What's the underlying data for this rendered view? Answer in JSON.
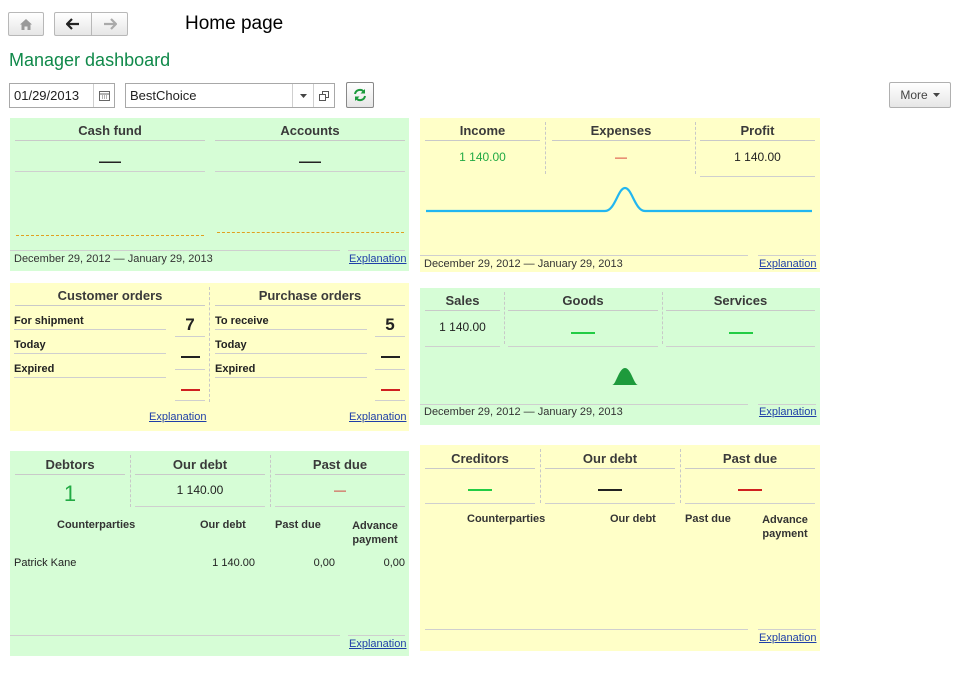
{
  "header": {
    "title": "Home page"
  },
  "dashboard": {
    "title": "Manager dashboard"
  },
  "filters": {
    "date": "01/29/2013",
    "company": "BestChoice",
    "more_label": "More"
  },
  "colors": {
    "green_panel": "#d6fdd6",
    "yellow_panel": "#ffffc8",
    "accent_green": "#10894a",
    "dash_red": "#d02020",
    "dash_green": "#22cc44",
    "link": "#1f3fa8"
  },
  "cash": {
    "cash_fund": "Cash fund",
    "accounts": "Accounts",
    "cash_fund_value": "—",
    "accounts_value": "—",
    "period": "December 29, 2012 — January 29, 2013",
    "explanation": "Explanation"
  },
  "income": {
    "income": "Income",
    "expenses": "Expenses",
    "profit": "Profit",
    "income_value": "1 140.00",
    "expenses_value": "—",
    "profit_value": "1 140.00",
    "period": "December 29, 2012 — January 29, 2013",
    "explanation": "Explanation"
  },
  "orders": {
    "customer": "Customer orders",
    "purchase": "Purchase orders",
    "customer_rows": [
      {
        "label": "For shipment",
        "value": "7"
      },
      {
        "label": "Today",
        "value": "—"
      },
      {
        "label": "Expired",
        "value": "—"
      }
    ],
    "purchase_rows": [
      {
        "label": "To receive",
        "value": "5"
      },
      {
        "label": "Today",
        "value": "—"
      },
      {
        "label": "Expired",
        "value": "—"
      }
    ],
    "explanation": "Explanation"
  },
  "sales": {
    "sales": "Sales",
    "goods": "Goods",
    "services": "Services",
    "sales_value": "1 140.00",
    "goods_value": "—",
    "services_value": "—",
    "period": "December 29, 2012 — January 29, 2013",
    "explanation": "Explanation"
  },
  "debtors": {
    "debtors": "Debtors",
    "our_debt": "Our debt",
    "past_due": "Past due",
    "debtors_value": "1",
    "our_debt_value": "1 140.00",
    "past_due_value": "—",
    "columns": [
      "Counterparties",
      "Our debt",
      "Past due",
      "Advance payment"
    ],
    "rows": [
      {
        "name": "Patrick Kane",
        "our_debt": "1 140.00",
        "past_due": "0,00",
        "advance": "0,00"
      }
    ],
    "explanation": "Explanation"
  },
  "creditors": {
    "creditors": "Creditors",
    "our_debt": "Our debt",
    "past_due": "Past due",
    "creditors_value": "—",
    "our_debt_value": "—",
    "past_due_value": "—",
    "columns": [
      "Counterparties",
      "Our debt",
      "Past due",
      "Advance payment"
    ],
    "explanation": "Explanation"
  }
}
